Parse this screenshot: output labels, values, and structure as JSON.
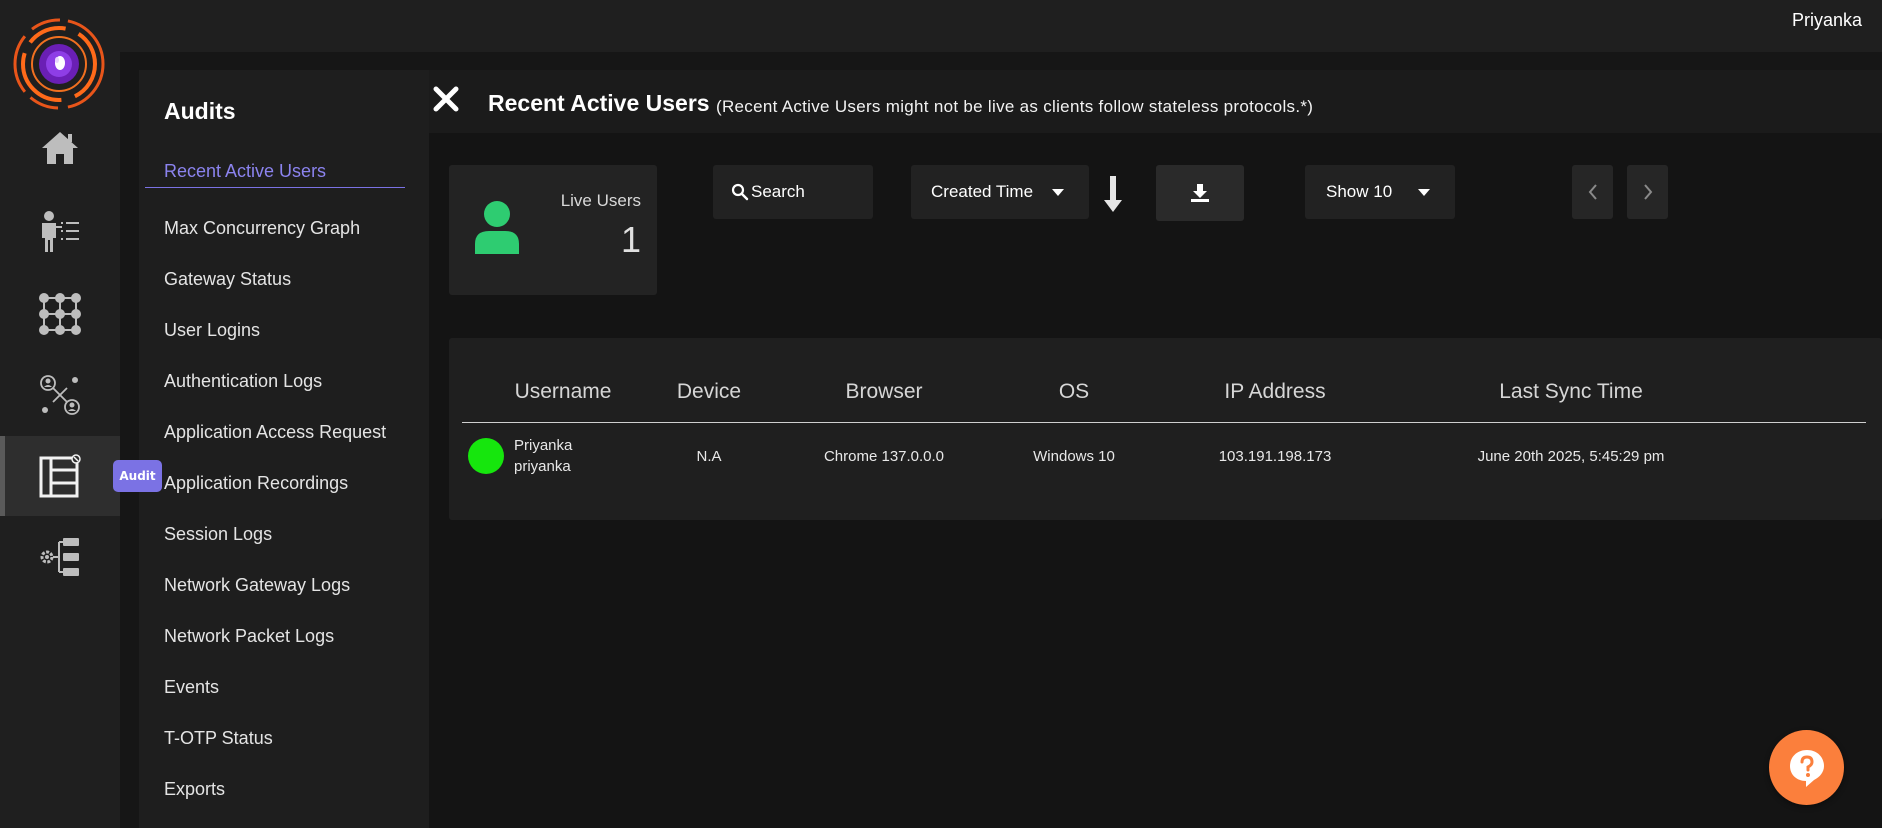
{
  "topbar": {
    "user_name": "Priyanka"
  },
  "rail": {
    "items": [
      {
        "icon": "home-icon"
      },
      {
        "icon": "user-list-icon"
      },
      {
        "icon": "grid-network-icon"
      },
      {
        "icon": "user-connections-icon"
      },
      {
        "icon": "audit-icon"
      },
      {
        "icon": "settings-tree-icon"
      }
    ],
    "tooltip": "Audit"
  },
  "submenu": {
    "title": "Audits",
    "items": [
      "Recent Active Users",
      "Max Concurrency Graph",
      "Gateway Status",
      "User Logins",
      "Authentication Logs",
      "Application Access Request",
      "Application Recordings",
      "Session Logs",
      "Network Gateway Logs",
      "Network Packet Logs",
      "Events",
      "T-OTP Status",
      "Exports"
    ]
  },
  "main": {
    "title": "Recent Active Users",
    "subtitle": "(Recent Active Users might not be live as clients follow stateless protocols.*)",
    "live_users": {
      "label": "Live Users",
      "value": "1"
    },
    "search_label": "Search",
    "sort_by": "Created Time",
    "show_count": "Show 10",
    "table": {
      "headers": [
        "Username",
        "Device",
        "Browser",
        "OS",
        "IP Address",
        "Last Sync Time"
      ],
      "rows": [
        {
          "name": "Priyanka",
          "username": "priyanka",
          "device": "N.A",
          "browser": "Chrome 137.0.0.0",
          "os": "Windows 10",
          "ip": "103.191.198.173",
          "last_sync": "June 20th 2025, 5:45:29 pm"
        }
      ]
    }
  },
  "colors": {
    "accent": "#7b72e4",
    "online": "#16e60d",
    "live_icon": "#2ecc71",
    "help": "#fb7f3c"
  }
}
